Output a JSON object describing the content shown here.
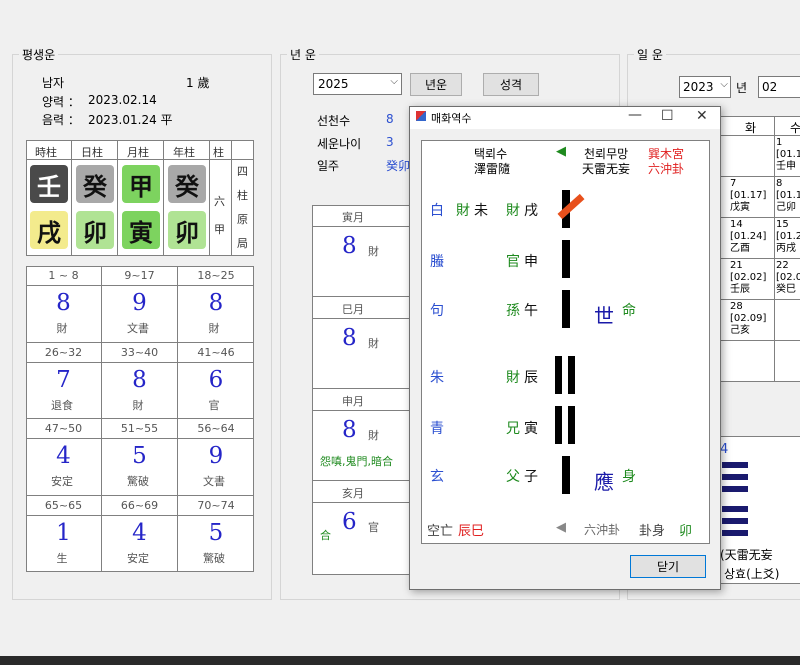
{
  "left": {
    "title": "평생운",
    "gender": "남자",
    "age": "1 歲",
    "solar_label": "양력 ：",
    "solar_date": "2023.02.14",
    "lunar_label": "음력 ：",
    "lunar_date": "2023.01.24 平",
    "pillar_headers": [
      "時柱",
      "日柱",
      "月柱",
      "年柱",
      "柱"
    ],
    "stems": [
      "壬",
      "癸",
      "甲",
      "癸"
    ],
    "branches": [
      "戌",
      "卯",
      "寅",
      "卯"
    ],
    "six_jia": "六甲",
    "four_pillar_label": "四柱原局",
    "grid": [
      {
        "range": "1 ~ 8",
        "num": "8",
        "label": "財"
      },
      {
        "range": "9~17",
        "num": "9",
        "label": "文書"
      },
      {
        "range": "18~25",
        "num": "8",
        "label": "財"
      },
      {
        "range": "26~32",
        "num": "7",
        "label": "退食"
      },
      {
        "range": "33~40",
        "num": "8",
        "label": "財"
      },
      {
        "range": "41~46",
        "num": "6",
        "label": "官"
      },
      {
        "range": "47~50",
        "num": "4",
        "label": "安定"
      },
      {
        "range": "51~55",
        "num": "5",
        "label": "驚破"
      },
      {
        "range": "56~64",
        "num": "9",
        "label": "文書"
      },
      {
        "range": "65~65",
        "num": "1",
        "label": "生"
      },
      {
        "range": "66~69",
        "num": "4",
        "label": "安定"
      },
      {
        "range": "70~74",
        "num": "5",
        "label": "驚破"
      }
    ]
  },
  "middle": {
    "title": "년 운",
    "year_value": "2025",
    "btn_year": "년운",
    "btn_personality": "성격",
    "row1_label": "선천수",
    "row1_value": "8",
    "row2_label": "세운나이",
    "row2_value": "3",
    "row3_label": "일주",
    "row3_value": "癸卯",
    "months": [
      {
        "name": "寅月",
        "num": "8",
        "label": "財",
        "extra": ""
      },
      {
        "name": "巳月",
        "num": "8",
        "label": "財",
        "extra": ""
      },
      {
        "name": "申月",
        "num": "8",
        "label": "財",
        "extra": "怨嗔,鬼門,暗合"
      },
      {
        "name": "亥月",
        "num": "6",
        "label": "官",
        "extra": "合"
      }
    ]
  },
  "right": {
    "title": "일 운",
    "year_value": "2023",
    "year_suffix": "년",
    "month_value": "02",
    "day_headers": [
      "화",
      "수"
    ],
    "cal": [
      {
        "d": "1",
        "l": "[01.1",
        "g": "壬申"
      },
      {
        "d": "7",
        "l": "[01.17]",
        "g": "戊寅"
      },
      {
        "d": "8",
        "l": "[01.1",
        "g": "己卯"
      },
      {
        "d": "14",
        "l": "[01.24]",
        "g": "乙酉"
      },
      {
        "d": "15",
        "l": "[01.2",
        "g": "丙戌"
      },
      {
        "d": "21",
        "l": "[02.02]",
        "g": "壬辰"
      },
      {
        "d": "22",
        "l": "[02.0",
        "g": "癸巳"
      },
      {
        "d": "28",
        "l": "[02.09]",
        "g": "己亥"
      }
    ],
    "hex_num": "4",
    "hex_name": "(天雷无妄",
    "hex_line": "상효(上爻)"
  },
  "dialog": {
    "title": "매화역수",
    "top_left_kr": "택뢰수",
    "top_left_hj": "澤雷隨",
    "arrow": "◀",
    "top_mid_kr": "천뢰무망",
    "top_mid_hj": "天雷无妄",
    "palace": "巽木宮",
    "clash": "六沖卦",
    "lines": [
      {
        "beast": "白",
        "rel1": "財",
        "br1": "未",
        "rel2": "財",
        "br2": "戌",
        "mark": "",
        "mark2": ""
      },
      {
        "beast": "螣",
        "rel1": "",
        "br1": "",
        "rel2": "官",
        "br2": "申",
        "mark": "",
        "mark2": ""
      },
      {
        "beast": "句",
        "rel1": "",
        "br1": "",
        "rel2": "孫",
        "br2": "午",
        "mark": "世",
        "mark2": "命"
      },
      {
        "beast": "朱",
        "rel1": "",
        "br1": "",
        "rel2": "財",
        "br2": "辰",
        "mark": "",
        "mark2": ""
      },
      {
        "beast": "青",
        "rel1": "",
        "br1": "",
        "rel2": "兄",
        "br2": "寅",
        "mark": "",
        "mark2": ""
      },
      {
        "beast": "玄",
        "rel1": "",
        "br1": "",
        "rel2": "父",
        "br2": "子",
        "mark": "應",
        "mark2": "身"
      }
    ],
    "void_label": "空亡",
    "void_value": "辰巳",
    "bottom_arrow": "◀",
    "bottom_clash": "六沖卦",
    "body_label": "卦身",
    "body_value": "卯",
    "close_label": "닫기",
    "colors": {
      "blue": "#2b4fd0",
      "green": "#1e8a1e",
      "red": "#e02020",
      "navy": "#1a1aa8"
    }
  }
}
